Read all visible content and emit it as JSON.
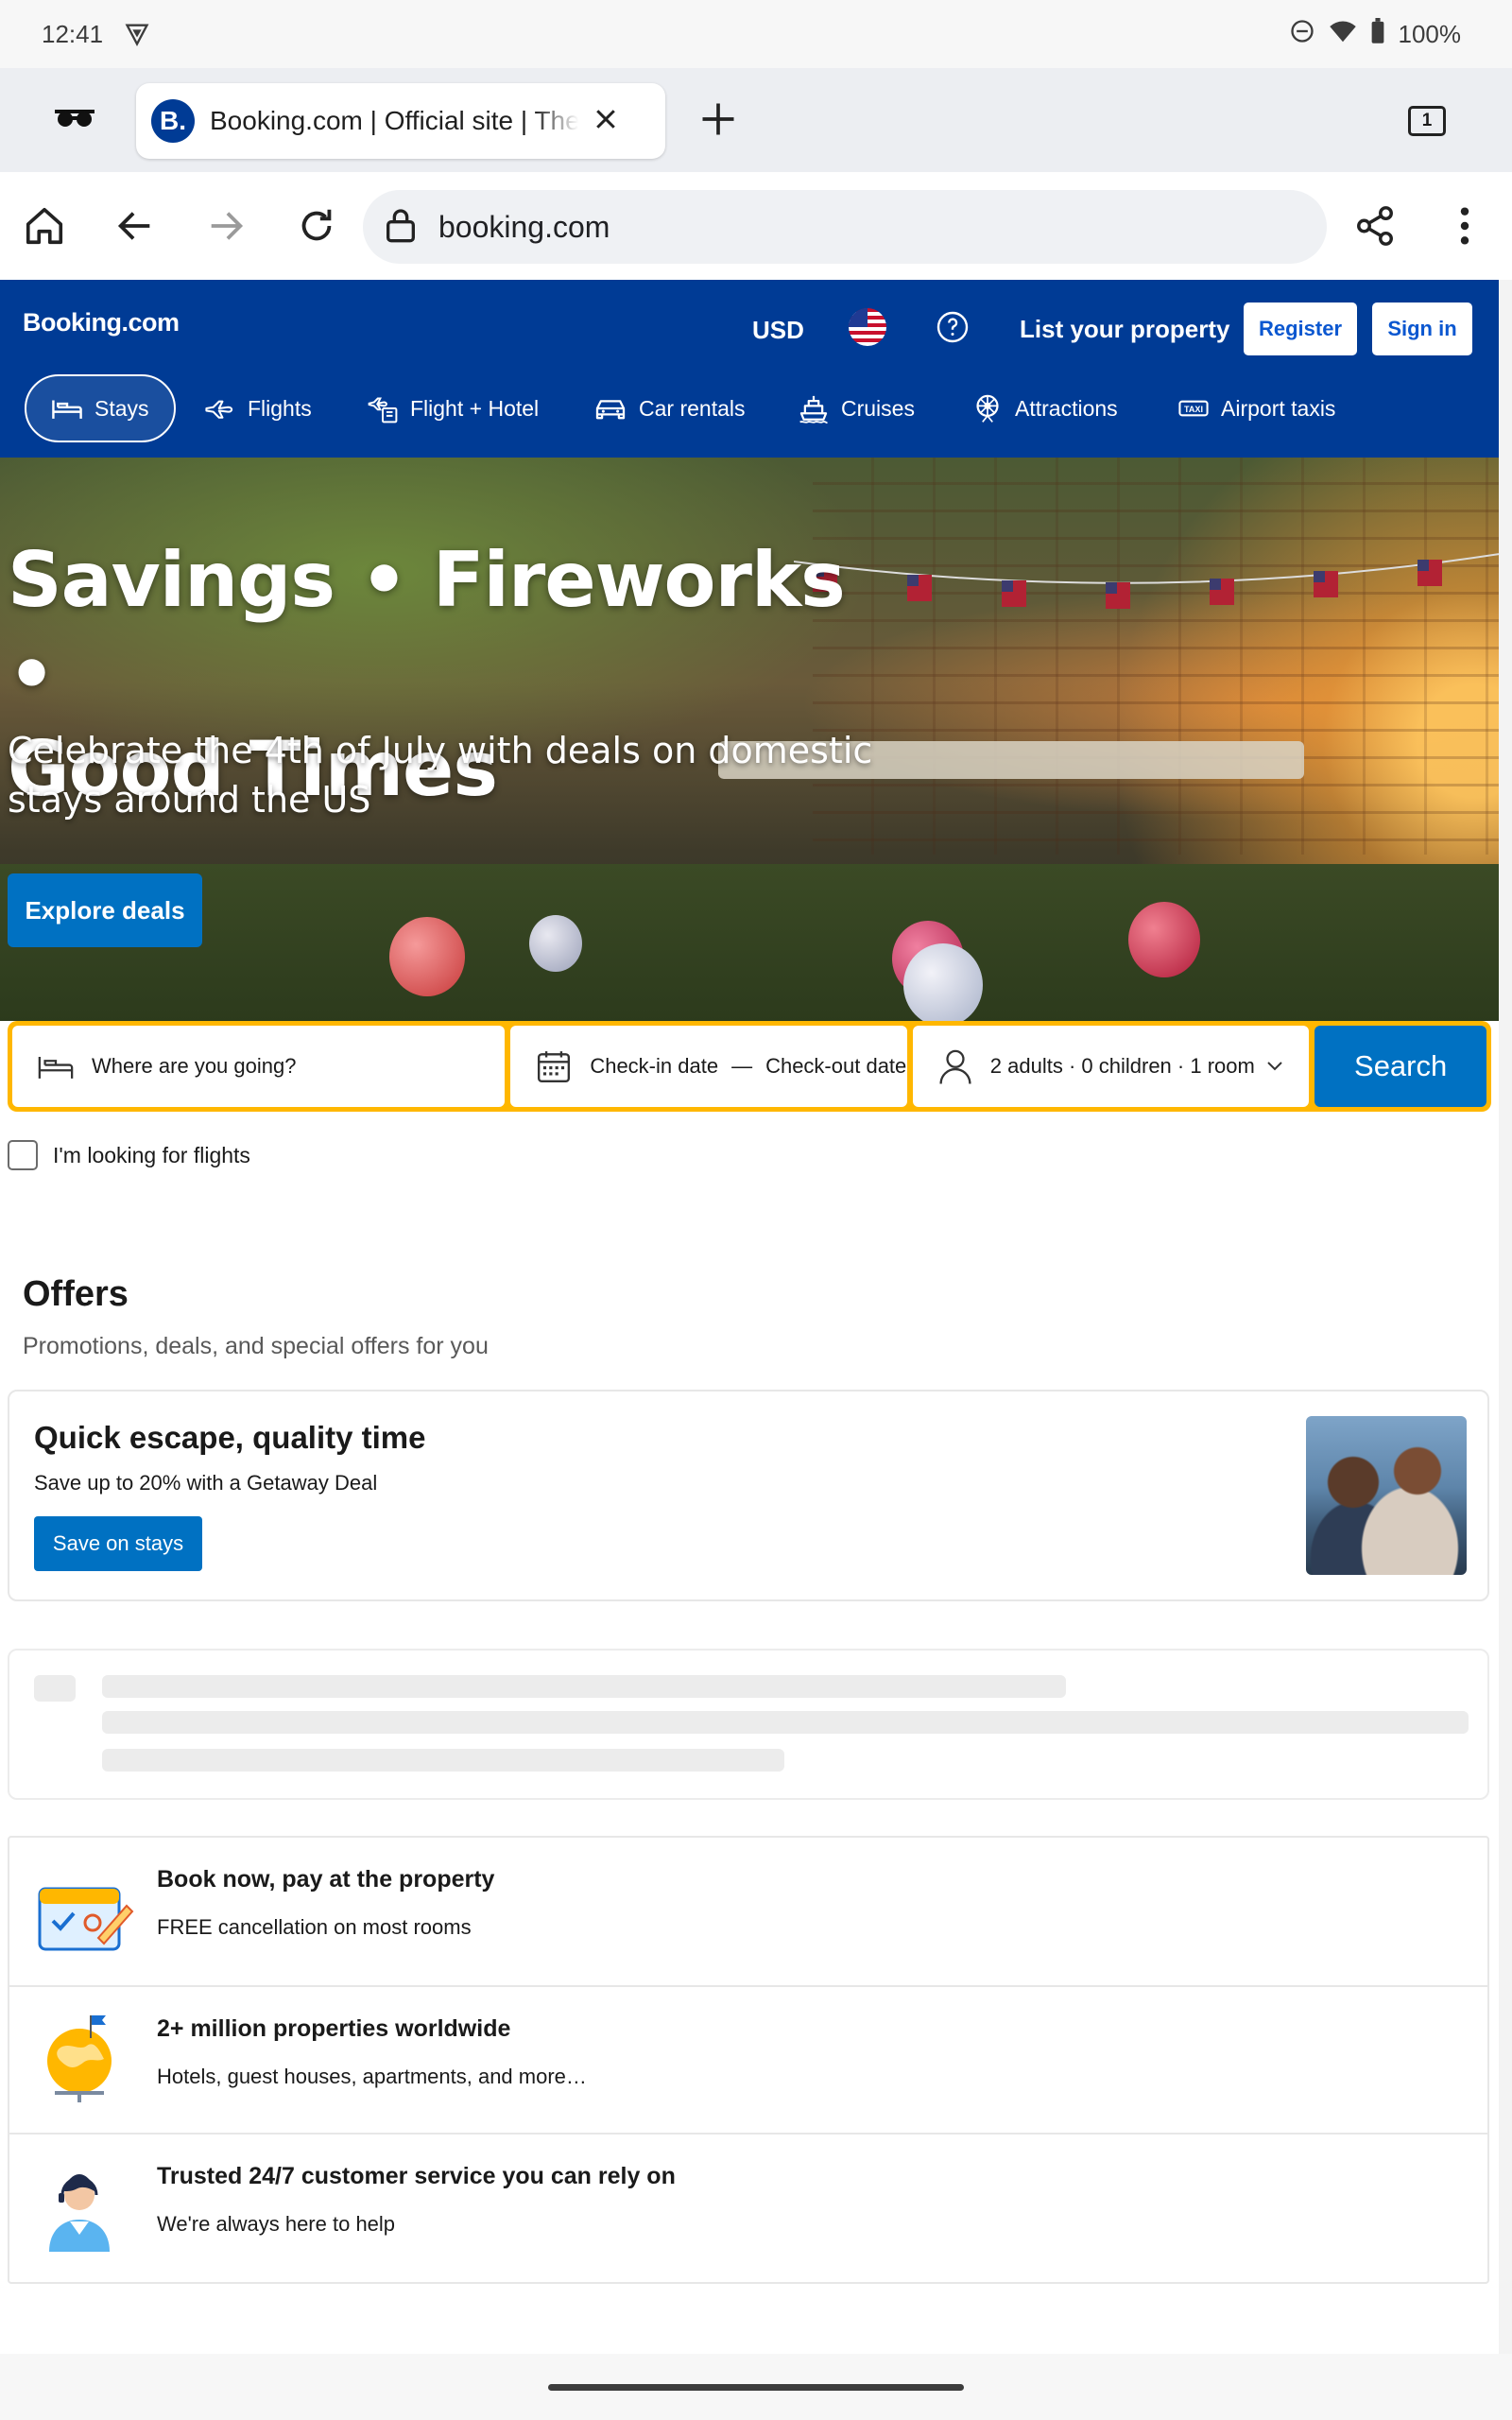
{
  "status_bar": {
    "time": "12:41",
    "battery": "100%"
  },
  "browser": {
    "tab_title": "Booking.com | Official site | The best hotels & flights",
    "tab_favicon": "B.",
    "tab_count": "1",
    "url": "booking.com"
  },
  "header": {
    "logo": "Booking.com",
    "currency": "USD",
    "list_property": "List your property",
    "register": "Register",
    "sign_in": "Sign in",
    "nav": [
      {
        "label": "Stays",
        "icon": "bed-icon"
      },
      {
        "label": "Flights",
        "icon": "plane-icon"
      },
      {
        "label": "Flight + Hotel",
        "icon": "flight-hotel-icon"
      },
      {
        "label": "Car rentals",
        "icon": "car-icon"
      },
      {
        "label": "Cruises",
        "icon": "ship-icon"
      },
      {
        "label": "Attractions",
        "icon": "attractions-icon"
      },
      {
        "label": "Airport taxis",
        "icon": "taxi-icon"
      }
    ]
  },
  "hero": {
    "title_line1": "Savings • Fireworks •",
    "title_line2": "Good Times",
    "subtitle": "Celebrate the 4th of July with deals on domestic stays around the US",
    "cta": "Explore deals"
  },
  "search": {
    "destination_placeholder": "Where are you going?",
    "checkin": "Check-in date",
    "separator": "—",
    "checkout": "Check-out date",
    "guests": "2 adults · 0 children · 1 room",
    "search_button": "Search",
    "flights_checkbox": "I'm looking for flights"
  },
  "offers": {
    "title": "Offers",
    "subtitle": "Promotions, deals, and special offers for you",
    "card": {
      "title": "Quick escape, quality time",
      "subtitle": "Save up to 20% with a Getaway Deal",
      "button": "Save on stays"
    }
  },
  "benefits": [
    {
      "title": "Book now, pay at the property",
      "subtitle": "FREE cancellation on most rooms",
      "icon": "calendar-check-icon"
    },
    {
      "title": "2+ million properties worldwide",
      "subtitle": "Hotels, guest houses, apartments, and more…",
      "icon": "globe-icon"
    },
    {
      "title": "Trusted 24/7 customer service you can rely on",
      "subtitle": "We're always here to help",
      "icon": "support-agent-icon"
    }
  ],
  "colors": {
    "brand_blue": "#003b95",
    "action_blue": "#0071c2",
    "search_yellow": "#ffb700"
  }
}
